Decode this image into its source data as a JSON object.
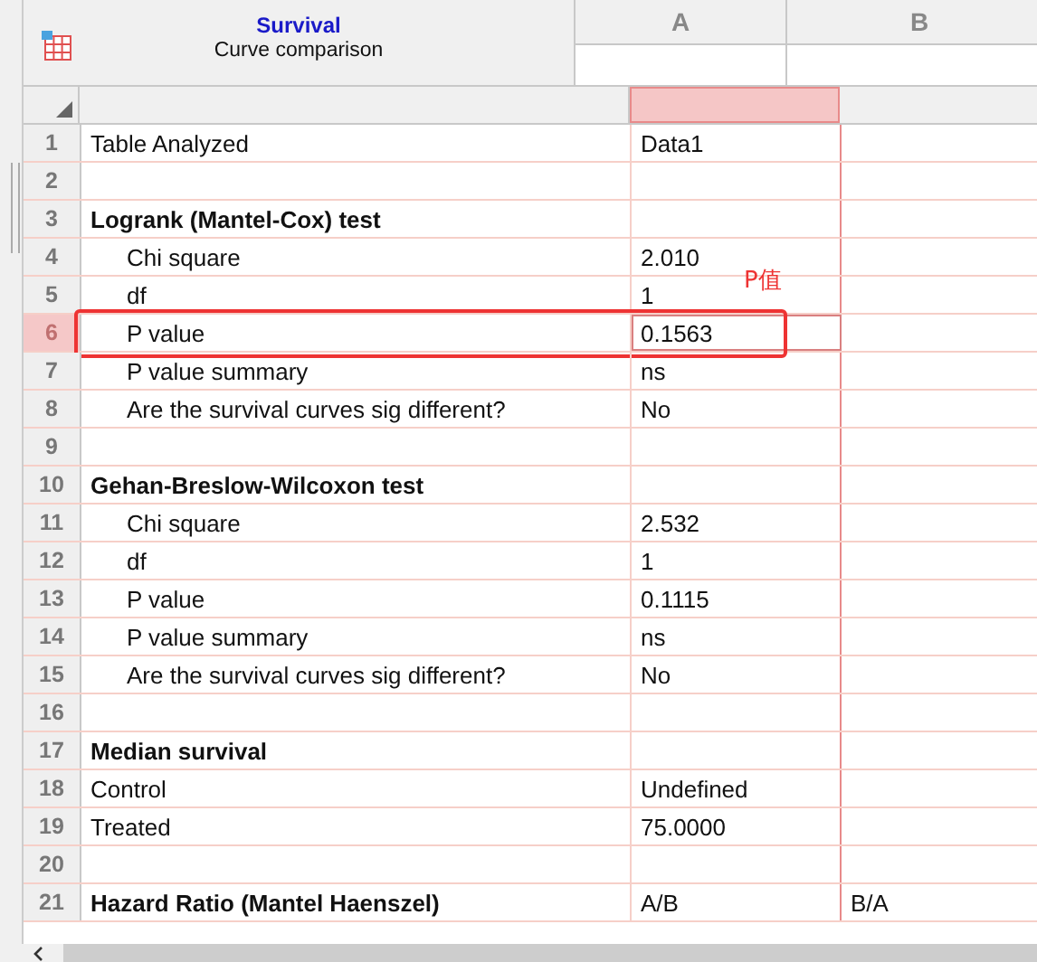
{
  "sheet": {
    "title": "Survival",
    "subtitle": "Curve comparison"
  },
  "columns": [
    {
      "label": "A",
      "selected": true
    },
    {
      "label": "B",
      "selected": false
    }
  ],
  "rows": [
    {
      "number": "1",
      "label": "Table Analyzed",
      "kind": "plain",
      "values": [
        "Data1"
      ],
      "selected": false
    },
    {
      "number": "2",
      "kind": "blank",
      "selected": false
    },
    {
      "number": "3",
      "label": "Logrank (Mantel-Cox) test",
      "kind": "heading",
      "selected": false
    },
    {
      "number": "4",
      "label": "Chi square",
      "kind": "item",
      "values": [
        "2.010"
      ],
      "selected": false
    },
    {
      "number": "5",
      "label": "df",
      "kind": "item",
      "values": [
        "1"
      ],
      "selected": false
    },
    {
      "number": "6",
      "label": "P value",
      "kind": "item",
      "values": [
        "0.1563"
      ],
      "selected": true,
      "annotation": "P值"
    },
    {
      "number": "7",
      "label": "P value summary",
      "kind": "item",
      "values": [
        "ns"
      ],
      "selected": false
    },
    {
      "number": "8",
      "label": "Are the survival curves sig different?",
      "kind": "item",
      "values": [
        "No"
      ],
      "selected": false
    },
    {
      "number": "9",
      "kind": "blank",
      "selected": false
    },
    {
      "number": "10",
      "label": "Gehan-Breslow-Wilcoxon test",
      "kind": "heading",
      "selected": false
    },
    {
      "number": "11",
      "label": "Chi square",
      "kind": "item",
      "values": [
        "2.532"
      ],
      "selected": false
    },
    {
      "number": "12",
      "label": "df",
      "kind": "item",
      "values": [
        "1"
      ],
      "selected": false
    },
    {
      "number": "13",
      "label": "P value",
      "kind": "item",
      "values": [
        "0.1115"
      ],
      "selected": false
    },
    {
      "number": "14",
      "label": "P value summary",
      "kind": "item",
      "values": [
        "ns"
      ],
      "selected": false
    },
    {
      "number": "15",
      "label": "Are the survival curves sig different?",
      "kind": "item",
      "values": [
        "No"
      ],
      "selected": false
    },
    {
      "number": "16",
      "kind": "blank",
      "selected": false
    },
    {
      "number": "17",
      "label": "Median survival",
      "kind": "heading",
      "selected": false
    },
    {
      "number": "18",
      "label": "Control",
      "kind": "plain",
      "values": [
        "Undefined"
      ],
      "selected": false
    },
    {
      "number": "19",
      "label": "Treated",
      "kind": "plain",
      "values": [
        "75.0000"
      ],
      "selected": false
    },
    {
      "number": "20",
      "kind": "blank",
      "selected": false
    },
    {
      "number": "21",
      "label": "Hazard Ratio (Mantel Haenszel)",
      "kind": "heading",
      "values": [
        "A/B",
        "B/A"
      ],
      "selected": false
    }
  ]
}
